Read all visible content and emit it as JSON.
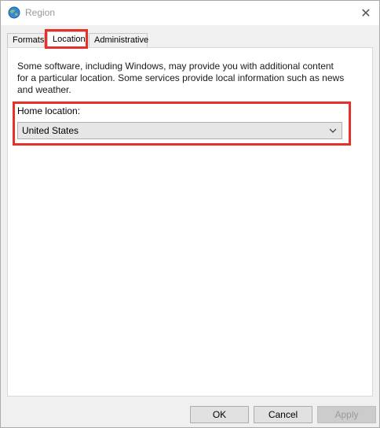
{
  "window": {
    "title": "Region",
    "close_glyph": "✕"
  },
  "tabs": [
    {
      "label": "Formats",
      "selected": false
    },
    {
      "label": "Location",
      "selected": true
    },
    {
      "label": "Administrative",
      "selected": false
    }
  ],
  "location": {
    "description": "Some software, including Windows, may provide you with additional content for a particular location. Some services provide local information such as news and weather.",
    "home_label": "Home location:",
    "home_value": "United States"
  },
  "buttons": {
    "ok": "OK",
    "cancel": "Cancel",
    "apply": "Apply"
  },
  "colors": {
    "highlight": "#e8302a",
    "panel": "#ffffff",
    "window_bg": "#f0f0f0"
  },
  "icons": {
    "app": "globe-icon",
    "close": "close-icon",
    "dropdown": "chevron-down-icon"
  }
}
